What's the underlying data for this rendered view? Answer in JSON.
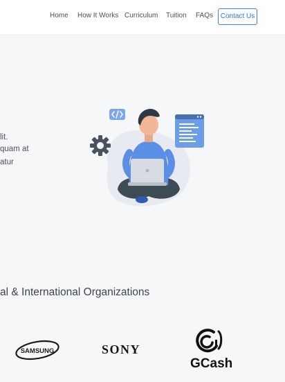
{
  "nav": {
    "links": [
      "Home",
      "How It Works",
      "Curriculum",
      "Tuition",
      "FAQs"
    ],
    "contact": "Contact Us"
  },
  "hero": {
    "lines": [
      "lit.",
      "quam at",
      "atur"
    ]
  },
  "orgs": {
    "heading": "al & International Organizations",
    "logos": [
      "SAMSUNG",
      "SONY",
      "GCash"
    ]
  },
  "colors": {
    "accent": "#3b82f6",
    "background": "#f6f7f9"
  }
}
